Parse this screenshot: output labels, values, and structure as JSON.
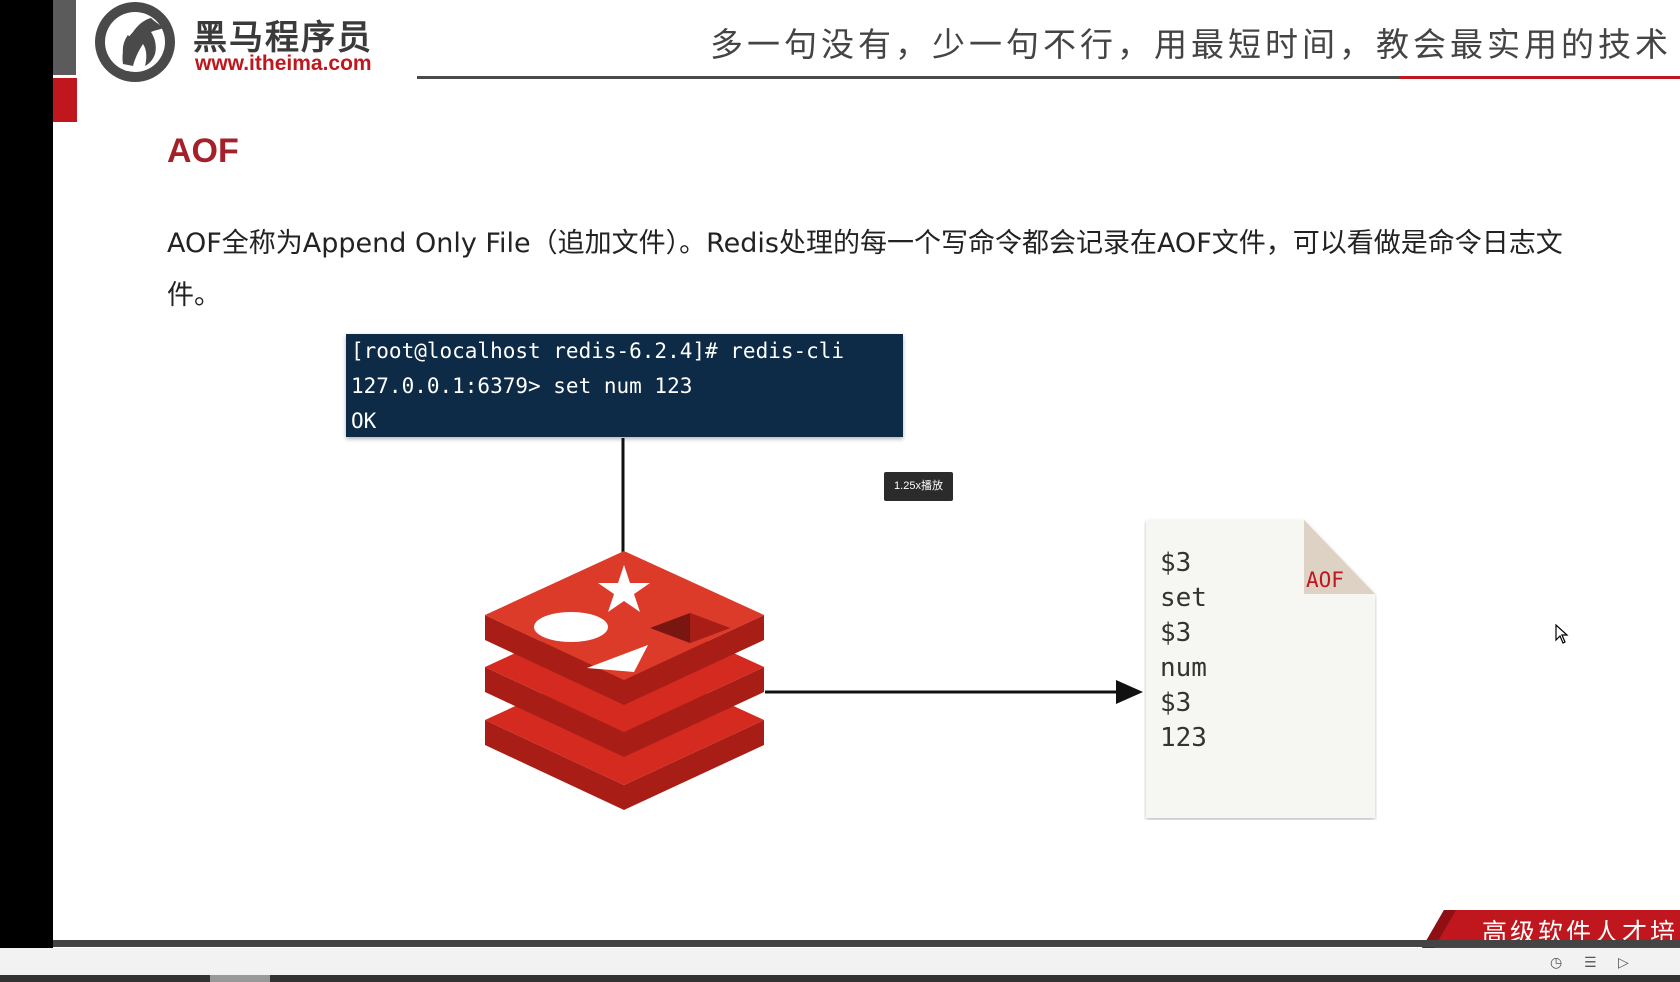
{
  "header": {
    "logo_name": "黑马程序员",
    "logo_url": "www.itheima.com",
    "slogan": "多一句没有，少一句不行，用最短时间，教会最实用的技术"
  },
  "slide": {
    "title": "AOF",
    "body_line1": "AOF全称为Append Only File（追加文件）。Redis处理的每一个写命令都会记录在AOF文件，可以看做是命令日志文",
    "body_line2": "件。"
  },
  "terminal": {
    "lines": [
      "[root@localhost redis-6.2.4]# redis-cli",
      "127.0.0.1:6379> set num 123",
      "OK"
    ]
  },
  "player": {
    "speed_tooltip": "1.25x播放"
  },
  "aof_file": {
    "tag": "AOF",
    "lines": [
      "$3",
      "set",
      "$3",
      "num",
      "$3",
      "123"
    ]
  },
  "footer": {
    "ribbon": "高级软件人才培"
  },
  "colors": {
    "brand_red": "#c0161d",
    "title_red": "#a3222a",
    "terminal_bg": "#0d2a46",
    "redis_red": "#d52a20"
  },
  "icons": {
    "cursor": "arrow-pointer-icon",
    "redis": "redis-logo-icon"
  }
}
